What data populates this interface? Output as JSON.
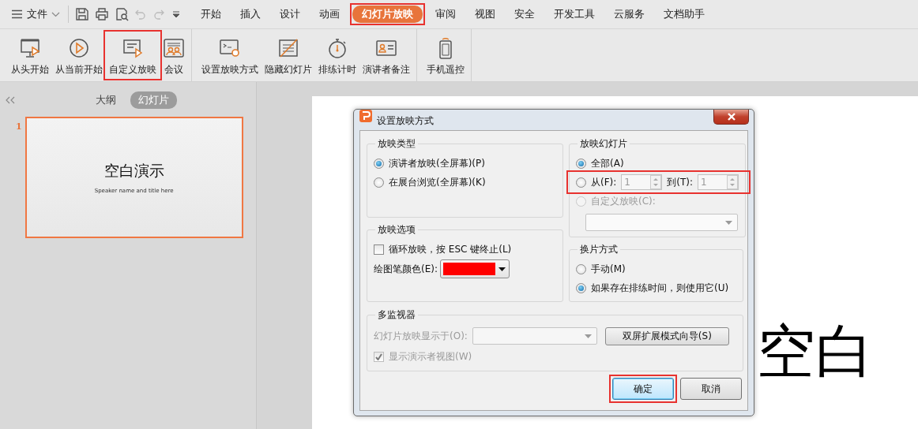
{
  "menu_bar": {
    "file_menu": "文件",
    "tabs": [
      {
        "label": "开始",
        "selected": false,
        "highlighted": false
      },
      {
        "label": "插入",
        "selected": false,
        "highlighted": false
      },
      {
        "label": "设计",
        "selected": false,
        "highlighted": false
      },
      {
        "label": "动画",
        "selected": false,
        "highlighted": false
      },
      {
        "label": "幻灯片放映",
        "selected": true,
        "highlighted": true
      },
      {
        "label": "审阅",
        "selected": false,
        "highlighted": false
      },
      {
        "label": "视图",
        "selected": false,
        "highlighted": false
      },
      {
        "label": "安全",
        "selected": false,
        "highlighted": false
      },
      {
        "label": "开发工具",
        "selected": false,
        "highlighted": false
      },
      {
        "label": "云服务",
        "selected": false,
        "highlighted": false
      },
      {
        "label": "文档助手",
        "selected": false,
        "highlighted": false
      }
    ]
  },
  "ribbon": {
    "groups": [
      [
        {
          "label": "从头开始",
          "highlighted": false
        },
        {
          "label": "从当前开始",
          "highlighted": false
        },
        {
          "label": "自定义放映",
          "highlighted": true
        },
        {
          "label": "会议",
          "highlighted": false
        }
      ],
      [
        {
          "label": "设置放映方式",
          "highlighted": false
        },
        {
          "label": "隐藏幻灯片",
          "highlighted": false
        },
        {
          "label": "排练计时",
          "highlighted": false
        },
        {
          "label": "演讲者备注",
          "highlighted": false
        }
      ],
      [
        {
          "label": "手机遥控",
          "highlighted": false
        }
      ]
    ]
  },
  "side_panel": {
    "view_tabs": [
      {
        "label": "大纲",
        "selected": false
      },
      {
        "label": "幻灯片",
        "selected": true
      }
    ],
    "thumbnails": [
      {
        "number": "1",
        "title": "空白演示",
        "subtitle": "Speaker name and title here",
        "selected": true
      }
    ]
  },
  "slide": {
    "title": "空白"
  },
  "dialog": {
    "title": "设置放映方式",
    "show_type": {
      "title": "放映类型",
      "options": [
        {
          "label": "演讲者放映(全屏幕)(P)",
          "selected": true
        },
        {
          "label": "在展台浏览(全屏幕)(K)",
          "selected": false
        }
      ]
    },
    "show_options": {
      "title": "放映选项",
      "loop": {
        "label": "循环放映，按 ESC 键终止(L)",
        "checked": false
      },
      "pen_color": {
        "label": "绘图笔颜色(E):",
        "color": "#ff0000"
      }
    },
    "slides": {
      "title": "放映幻灯片",
      "options": [
        {
          "kind": "all",
          "label": "全部(A)",
          "selected": true,
          "disabled": false,
          "highlighted": false
        },
        {
          "kind": "range",
          "label": "从(F):",
          "selected": false,
          "disabled": false,
          "highlighted": true,
          "from": "1",
          "to_label": "到(T):",
          "to": "1"
        },
        {
          "kind": "custom",
          "label": "自定义放映(C):",
          "selected": false,
          "disabled": true,
          "highlighted": false
        }
      ]
    },
    "advance": {
      "title": "换片方式",
      "options": [
        {
          "label": "手动(M)",
          "selected": false
        },
        {
          "label": "如果存在排练时间，则使用它(U)",
          "selected": true
        }
      ]
    },
    "monitors": {
      "title": "多监视器",
      "display_label": "幻灯片放映显示于(O):",
      "disabled": true,
      "wizard_button": "双屏扩展模式向导(S)",
      "presenter_view": {
        "label": "显示演示者视图(W)",
        "checked": true,
        "disabled": true
      }
    },
    "buttons": [
      {
        "label": "确定",
        "kind": "primary",
        "highlighted": true
      },
      {
        "label": "取消",
        "kind": "normal",
        "highlighted": false
      }
    ]
  }
}
